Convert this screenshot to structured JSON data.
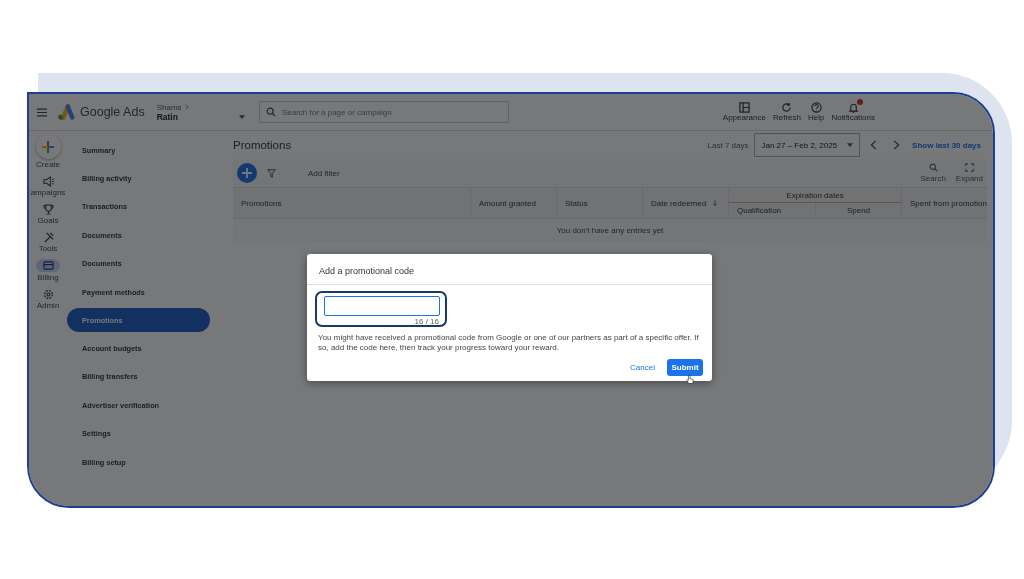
{
  "topbar": {
    "brand": "Google Ads",
    "account_parent": "Shams",
    "account_name": "Ratin",
    "search": {
      "placeholder": "Search for a page or campaign"
    },
    "actions": [
      {
        "label": "Appearance",
        "kind": "appearance",
        "badge": false
      },
      {
        "label": "Refresh",
        "kind": "refresh",
        "badge": false
      },
      {
        "label": "Help",
        "kind": "help",
        "badge": false
      },
      {
        "label": "Notifications",
        "kind": "bell",
        "badge": true
      }
    ]
  },
  "rail": [
    {
      "label": "Create",
      "kind": "create",
      "selected": false
    },
    {
      "label": "ampaigns",
      "kind": "campaigns",
      "selected": false
    },
    {
      "label": "Goals",
      "kind": "goals",
      "selected": false
    },
    {
      "label": "Tools",
      "kind": "tools",
      "selected": false
    },
    {
      "label": "Billing",
      "kind": "billing",
      "selected": true
    },
    {
      "label": "Admin",
      "kind": "admin",
      "selected": false
    }
  ],
  "nav": [
    {
      "label": "Summary",
      "selected": false
    },
    {
      "label": "Billing activity",
      "selected": false
    },
    {
      "label": "Transactions",
      "selected": false
    },
    {
      "label": "Documents",
      "selected": false
    },
    {
      "label": "Documents",
      "selected": false
    },
    {
      "label": "Payment methods",
      "selected": false
    },
    {
      "label": "Promotions",
      "selected": true
    },
    {
      "label": "Account budgets",
      "selected": false
    },
    {
      "label": "Billing transfers",
      "selected": false
    },
    {
      "label": "Advertiser verification",
      "selected": false
    },
    {
      "label": "Settings",
      "selected": false
    },
    {
      "label": "Billing setup",
      "selected": false
    }
  ],
  "page": {
    "title": "Promotions",
    "range_label": "Last 7 days",
    "date_range": "Jan 27 – Feb 2, 2025",
    "show_link": "Show last 30 days"
  },
  "toolbar": {
    "filter": "Add filter",
    "tools": [
      {
        "label": "Search",
        "kind": "search"
      },
      {
        "label": "Expand",
        "kind": "expand"
      }
    ]
  },
  "table": {
    "columns": [
      {
        "label": "Promotions",
        "sorted": false
      },
      {
        "label": "Amount granted",
        "sorted": false
      },
      {
        "label": "Status",
        "sorted": false
      },
      {
        "label": "Date redeemed",
        "sorted": true
      }
    ],
    "group": "Expiration dates",
    "subcolumns": [
      "Qualification",
      "Spend"
    ],
    "last_column": "Spent from promotion",
    "empty": "You don't have any entries yet"
  },
  "dialog": {
    "title": "Add a promotional code",
    "counter": "16 / 16",
    "help": "You might have received a promotional code from Google or one of our partners as part of a specific offer. If so, add the code here, then track your progress toward your reward.",
    "buttons": [
      {
        "label": "Cancel",
        "kind": "text"
      },
      {
        "label": "Submit",
        "kind": "primary"
      }
    ]
  }
}
